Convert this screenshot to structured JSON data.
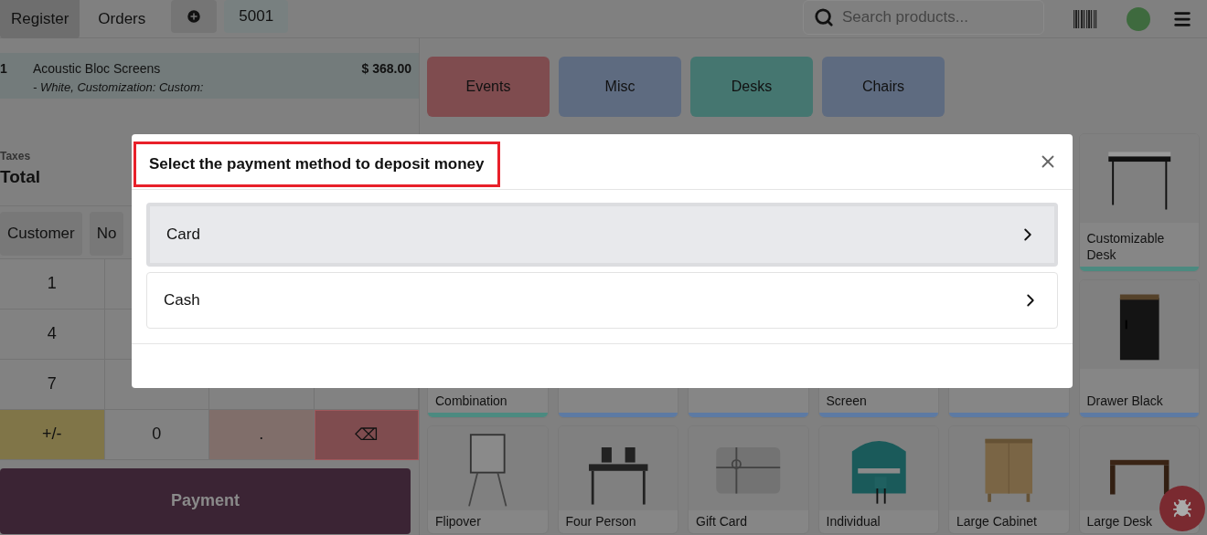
{
  "topbar": {
    "tabs": [
      {
        "label": "Register",
        "selected": true
      },
      {
        "label": "Orders",
        "selected": false
      }
    ],
    "order_tab": "5001",
    "search": {
      "placeholder": "Search products..."
    }
  },
  "order": {
    "lines": [
      {
        "qty": "1",
        "name": "Acoustic Bloc Screens",
        "attributes": "- White, Customization: Custom:",
        "price": "$ 368.00"
      }
    ],
    "taxes_label": "Taxes",
    "total_label": "Total"
  },
  "actions": [
    "Customer",
    "No"
  ],
  "numpad": [
    [
      {
        "label": "1",
        "kind": "digit"
      }
    ],
    [
      {
        "label": "4",
        "kind": "digit"
      }
    ],
    [
      {
        "label": "7",
        "kind": "digit"
      }
    ],
    [
      {
        "label": "+/-",
        "kind": "sign"
      },
      {
        "label": "0",
        "kind": "digit"
      },
      {
        "label": ".",
        "kind": "decimal"
      },
      {
        "label": "⌫",
        "kind": "backspace"
      }
    ]
  ],
  "payment_button": "Payment",
  "categories": [
    {
      "label": "Events",
      "color": "#7f4c4f"
    },
    {
      "label": "Misc",
      "color": "#5e6b80"
    },
    {
      "label": "Desks",
      "color": "#457670"
    },
    {
      "label": "Chairs",
      "color": "#5e6b80"
    }
  ],
  "product_rows": [
    [
      {
        "kind": "covered"
      },
      {
        "kind": "covered"
      },
      {
        "kind": "covered"
      },
      {
        "kind": "covered"
      },
      {
        "kind": "covered"
      },
      {
        "kind": "card",
        "name": "Customizable Desk",
        "color": "#4c8a80"
      }
    ],
    [
      {
        "kind": "caption",
        "name": "Combination",
        "color": "#4c8a80"
      },
      {
        "kind": "caption",
        "color": "#5d7aa3"
      },
      {
        "kind": "caption",
        "color": "#5d7aa3"
      },
      {
        "kind": "caption",
        "name": "Screen",
        "color": "#5d7aa3"
      },
      {
        "kind": "caption",
        "color": "#5d7aa3"
      },
      {
        "kind": "card",
        "name": "Drawer Black",
        "color": "#5d7aa3"
      }
    ],
    [
      {
        "kind": "card",
        "name": "Flipover"
      },
      {
        "kind": "card",
        "name": "Four Person"
      },
      {
        "kind": "card",
        "name": "Gift Card"
      },
      {
        "kind": "card",
        "name": "Individual"
      },
      {
        "kind": "card",
        "name": "Large Cabinet"
      },
      {
        "kind": "card",
        "name": "Large Desk"
      }
    ]
  ],
  "dialog": {
    "title": "Select the payment method to deposit money",
    "methods": [
      {
        "label": "Card",
        "selected": true
      },
      {
        "label": "Cash",
        "selected": false
      }
    ]
  }
}
